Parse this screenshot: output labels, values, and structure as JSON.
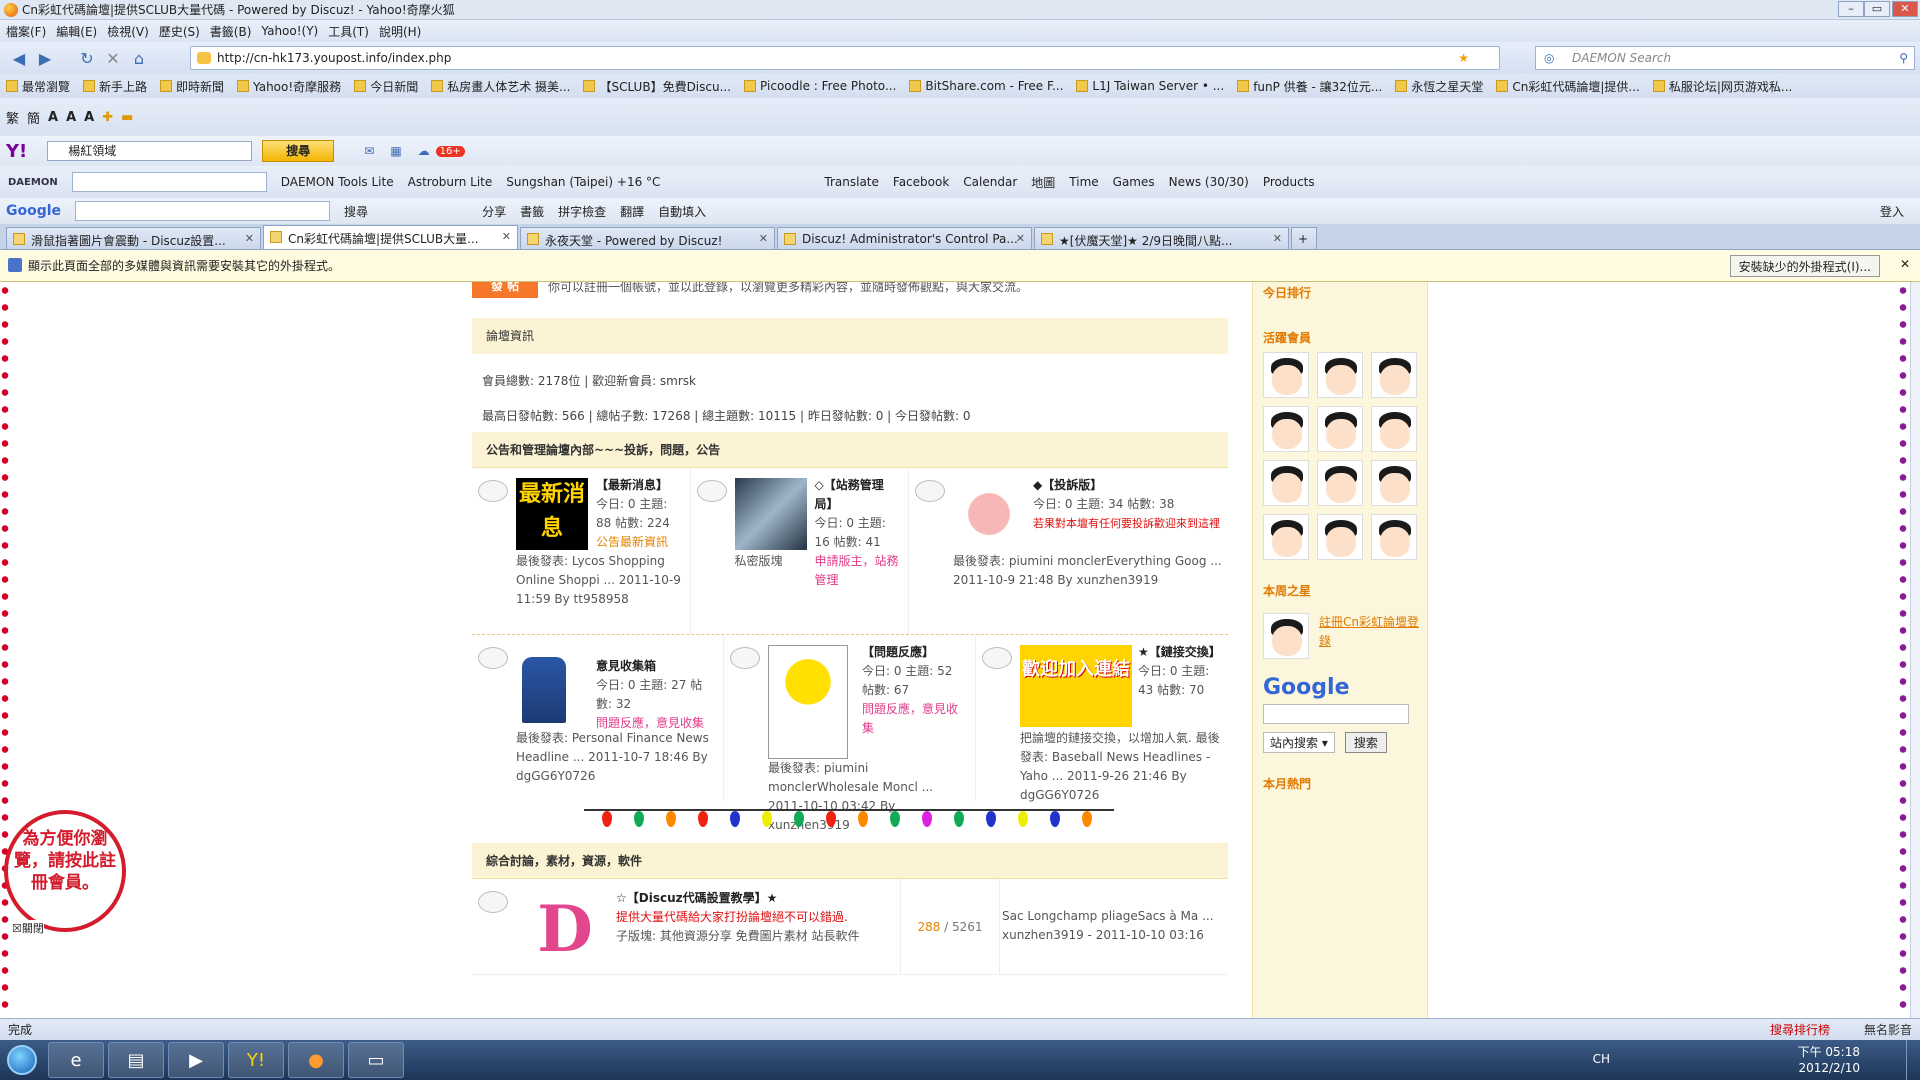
{
  "window": {
    "title": "Cn彩虹代碼論壇|提供SCLUB大量代碼 - Powered by Discuz! - Yahoo!奇摩火狐"
  },
  "menu": [
    "檔案(F)",
    "編輯(E)",
    "檢視(V)",
    "歷史(S)",
    "書籤(B)",
    "Yahoo!(Y)",
    "工具(T)",
    "說明(H)"
  ],
  "nav": {
    "url": "http://cn-hk173.youpost.info/index.php",
    "search_placeholder": "DAEMON Search"
  },
  "bookmarks": [
    "最常瀏覽",
    "新手上路",
    "即時新聞",
    "Yahoo!奇摩服務",
    "今日新聞",
    "私房畫人体艺术 摄美...",
    "【SCLUB】免費Discu...",
    "Picoodle : Free Photo...",
    "BitShare.com - Free F...",
    "L1J Taiwan Server • ...",
    "funP 供養 - 讓32位元...",
    "永恆之星天堂",
    "Cn彩虹代碼論壇|提供...",
    "私服论坛|网页游戏私..."
  ],
  "yahoo_toolbar": {
    "search_value": "楊紅領域",
    "search_button": "搜尋",
    "badge": "16+"
  },
  "daemon_toolbar": {
    "items": [
      "DAEMON Tools Lite",
      "Astroburn Lite",
      "Sungshan (Taipei) +16 °C",
      "Translate",
      "Facebook",
      "Calendar",
      "地圖",
      "Time",
      "Games",
      "News (30/30)",
      "Products"
    ]
  },
  "google_toolbar": {
    "logo": "Google",
    "items": [
      "搜尋",
      "分享",
      "書籤",
      "拼字檢查",
      "翻譯",
      "自動填入"
    ],
    "signin": "登入"
  },
  "tabs": [
    {
      "label": "滑鼠指著圖片會震動 - Discuz設置..."
    },
    {
      "label": "Cn彩虹代碼論壇|提供SCLUB大量..."
    },
    {
      "label": "永夜天堂 - Powered by Discuz!"
    },
    {
      "label": "Discuz! Administrator's Control Pa..."
    },
    {
      "label": "★[伏魔天堂]★ 2/9日晚間八點..."
    }
  ],
  "plugin_bar": {
    "message": "顯示此頁面全部的多媒體與資訊需要安裝其它的外掛程式。",
    "button": "安裝缺少的外掛程式(I)..."
  },
  "forum": {
    "intro": "你可以註冊一個帳號，並以此登錄，以瀏覽更多精彩內容，並隨時發佈觀點，與大家交流。",
    "post_button": "發 帖",
    "info_header": "論壇資訊",
    "stats1": "會員總數: 2178位  |  歡迎新會員: smrsk",
    "stats2": "最高日發帖數: 566  |  總帖子數: 17268  |  總主題數: 10115  |  昨日發帖數: 0  |  今日發帖數: 0",
    "section1": "公告和管理論壇內部~~~投訴，問題，公告",
    "forums": [
      {
        "name": "【最新消息】",
        "stats": "今日: 0 主題: 88 帖數: 224",
        "desc": "公告最新資訊",
        "last": "最後發表: Lycos Shopping Online Shoppi ...  2011-10-9 11:59 By tt958958",
        "thumb": "最新消息"
      },
      {
        "name": "◇【站務管理局】",
        "stats": "今日: 0 主題: 16 帖數: 41",
        "desc": "申請版主，站務管理",
        "last": "私密版塊",
        "thumb": ""
      },
      {
        "name": "◆【投訴版】",
        "stats": "今日: 0 主題: 34 帖數: 38",
        "desc": "若果對本壇有任何要投訴歡迎來到這裡",
        "last": "最後發表: piumini monclerEverything Goog ...  2011-10-9 21:48 By xunzhen3919",
        "thumb": ""
      },
      {
        "name": "意見收集箱",
        "stats": "今日: 0 主題: 27 帖數: 32",
        "desc": "問題反應，意見收集",
        "last": "最後發表: Personal Finance News Headline ...  2011-10-7 18:46 By dgGG6Y0726",
        "thumb": ""
      },
      {
        "name": "【問題反應】",
        "stats": "今日: 0 主題: 52 帖數: 67",
        "desc": "問題反應，意見收集",
        "last": "最後發表: piumini monclerWholesale Moncl ...  2011-10-10 03:42 By xunzhen3919",
        "thumb": ""
      },
      {
        "name": "★【鏈接交換】",
        "stats": "今日: 0 主題: 43 帖數: 70",
        "desc": "",
        "last": "把論壇的鏈接交換，以增加人氣. 最後發表: Baseball News Headlines - Yaho ...  2011-9-26 21:46 By dgGG6Y0726",
        "thumb": "歡迎加入連結"
      }
    ],
    "section2": "綜合討論，素材，資源，軟件",
    "discuz": {
      "name": "☆【Discuz代碼設置教學】★",
      "desc": "提供大量代碼給大家打扮論壇絕不可以錯過.",
      "sub": "子版塊: 其他資源分享  免費圖片素材  站長軟件",
      "count_a": "288",
      "count_b": "5261",
      "last": "Sac Longchamp pliageSacs à Ma ...",
      "last_by": "xunzhen3919 - 2011-10-10 03:16"
    }
  },
  "sidebar": {
    "today_rank": "今日排行",
    "active": "活躍會員",
    "star": "本周之星",
    "star_link": "註冊Cn彩虹論壇登錄",
    "google": "Google",
    "site_search": "站內搜索",
    "search_btn": "搜索",
    "hot": "本月熱門"
  },
  "stamp": {
    "text": "為方便你瀏覽，請按此註冊會員。",
    "close": "關閉"
  },
  "status": {
    "text": "完成",
    "right1": "搜尋排行榜",
    "right2": "無名影音"
  },
  "taskbar": {
    "lang": "CH",
    "time": "下午 05:18",
    "date": "2012/2/10"
  }
}
